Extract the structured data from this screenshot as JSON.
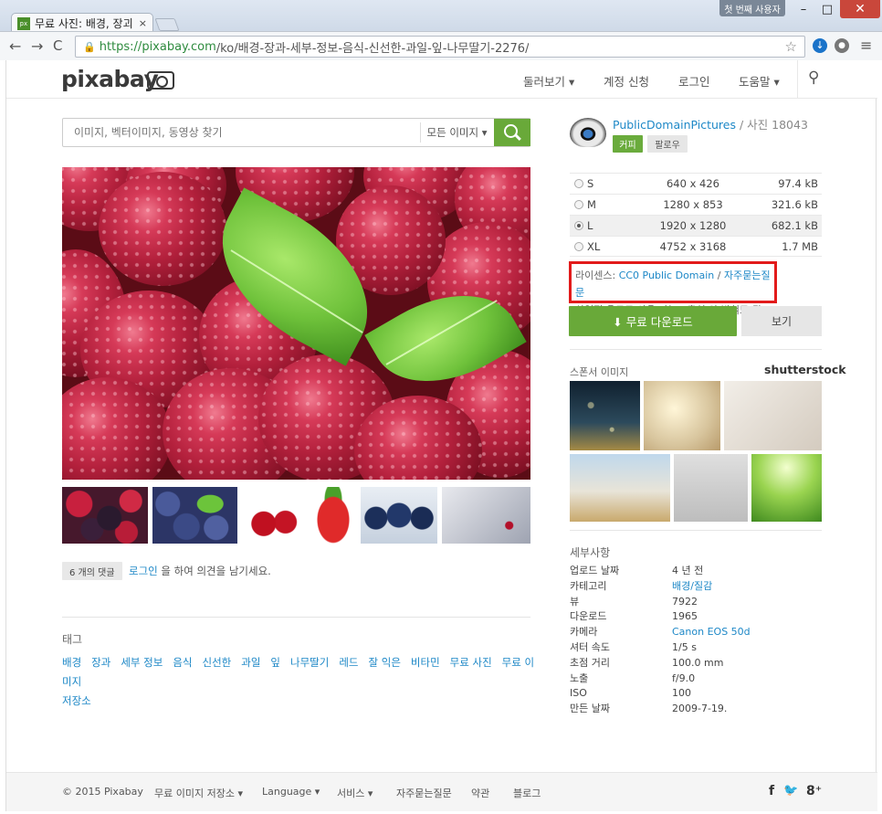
{
  "browser": {
    "tab_title": "무료 사진: 배경, 장괴",
    "tab_favicon": "px",
    "close_tab": "×",
    "user_badge": "첫 번째 사용자",
    "url_scheme": "https://",
    "url_host": "pixabay.com",
    "url_path": "/ko/배경-장과-세부-정보-음식-신선한-과일-잎-나무딸기-2276/",
    "win_min": "–",
    "win_max": "□",
    "win_close": "✕"
  },
  "site": {
    "logo": "pixabay",
    "nav": [
      "둘러보기 ▾",
      "계정 신청",
      "로그인",
      "도움말 ▾"
    ]
  },
  "search": {
    "placeholder": "이미지, 벡터이미지, 동영상 찾기",
    "type": "모든 이미지 ▾"
  },
  "author": {
    "name": "PublicDomainPictures",
    "photos": " / 사진 18043",
    "coffee": "커피",
    "follow": "팔로우"
  },
  "sizes": [
    {
      "name": "S",
      "dim": "640 x 426",
      "kb": "97.4 kB",
      "selected": false
    },
    {
      "name": "M",
      "dim": "1280 x 853",
      "kb": "321.6 kB",
      "selected": false
    },
    {
      "name": "L",
      "dim": "1920 x 1280",
      "kb": "682.1 kB",
      "selected": true
    },
    {
      "name": "XL",
      "dim": "4752 x 3168",
      "kb": "1.7 MB",
      "selected": false
    }
  ],
  "license": {
    "label": "라이센스: ",
    "name": "CC0 Public Domain",
    "sep": " / ",
    "faq": "자주묻는질문",
    "line2": "상업적 용도로 사용 가능 / 출처 안 밝혀도 됨"
  },
  "download_label": "⬇ 무료 다운로드",
  "view_label": "보기",
  "sponsor": {
    "title": "스폰서 이미지",
    "logo": "shutterstock"
  },
  "comments": {
    "badge": "6 개의 댓글",
    "login": "로그인",
    "text": " 을 하여 의견을 남기세요."
  },
  "tags_title": "태그",
  "tags": [
    "배경",
    "장과",
    "세부 정보",
    "음식",
    "신선한",
    "과일",
    "잎",
    "나무딸기",
    "레드",
    "잘 익은",
    "비타민",
    "무료 사진",
    "무료 이미지",
    "저장소"
  ],
  "details_title": "세부사항",
  "details": [
    {
      "k": "업로드 날짜",
      "v": "4 년 전",
      "link": false
    },
    {
      "k": "카테고리",
      "v": "배경/질감",
      "link": true
    },
    {
      "k": "뷰",
      "v": "7922",
      "link": false
    },
    {
      "k": "다운로드",
      "v": "1965",
      "link": false
    },
    {
      "k": "카메라",
      "v": "Canon EOS 50d",
      "link": true
    },
    {
      "k": "셔터 속도",
      "v": "1/5 s",
      "link": false
    },
    {
      "k": "초점 거리",
      "v": "100.0 mm",
      "link": false
    },
    {
      "k": "노출",
      "v": "f/9.0",
      "link": false
    },
    {
      "k": "ISO",
      "v": "100",
      "link": false
    },
    {
      "k": "만든 날짜",
      "v": "2009-7-19.",
      "link": false
    }
  ],
  "footer": {
    "copyright": "© 2015 Pixabay",
    "items": [
      "무료 이미지 저장소 ▾",
      "Language ▾",
      "서비스 ▾",
      "자주묻는질문",
      "약관",
      "블로그"
    ],
    "social": [
      "f",
      "🐦",
      "8⁺"
    ]
  },
  "colors": {
    "accent": "#69a939",
    "link": "#1e88c7",
    "highlight_box": "#e21b1b"
  }
}
